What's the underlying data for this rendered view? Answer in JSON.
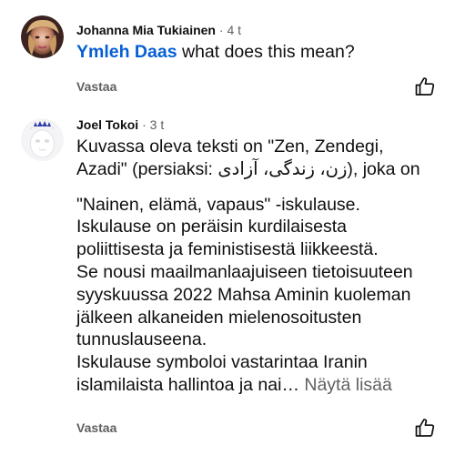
{
  "comments": [
    {
      "author": "Johanna Mia Tukiainen",
      "separator": "·",
      "age": "4 t",
      "mention": "Ymleh Daas",
      "text": "what does this mean?",
      "reply_label": "Vastaa",
      "like_icon": "thumb-up-icon"
    },
    {
      "author": "Joel Tokoi",
      "separator": "·",
      "age": "3 t",
      "lines": [
        "Kuvassa oleva teksti on \"Zen, Zendegi,",
        "Azadi\" (persiaksi: زن، زندگی، آزادی), joka on",
        "\"Nainen, elämä, vapaus\" -iskulause.",
        "Iskulause on peräisin kurdilaisesta",
        "poliittisesta ja feministisestä liikkeestä.",
        "Se nousi maailmanlaajuiseen tietoisuuteen",
        "syyskuussa 2022 Mahsa Aminin kuoleman",
        "jälkeen alkaneiden mielenosoitusten",
        "tunnuslauseena.",
        "Iskulause symboloi vastarintaa Iranin",
        "islamilaista hallintoa ja nai…"
      ],
      "show_more": "Näytä lisää",
      "reply_label": "Vastaa",
      "like_icon": "thumb-up-icon"
    }
  ],
  "colors": {
    "mention": "#065fd4",
    "text": "#0f0f0f",
    "secondary": "#606060"
  }
}
